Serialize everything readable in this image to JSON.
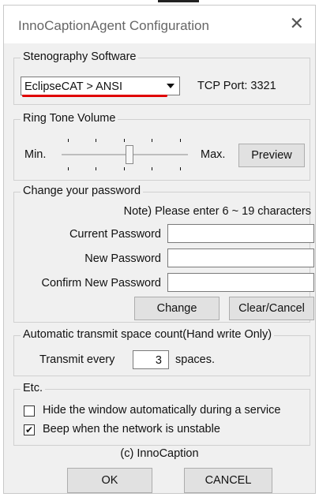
{
  "window": {
    "title": "InnoCaptionAgent Configuration",
    "close_glyph": "✕"
  },
  "steno": {
    "legend": "Stenography Software",
    "selected": "EclipseCAT > ANSI",
    "dropdown_glyph": "▼",
    "tcp_port": "TCP Port: 3321"
  },
  "ring": {
    "legend": "Ring Tone Volume",
    "min_label": "Min.",
    "max_label": "Max.",
    "volume_fraction": 0.55,
    "preview_label": "Preview"
  },
  "password": {
    "legend": "Change your password",
    "note": "Note) Please enter 6 ~ 19 characters",
    "current_label": "Current Password",
    "new_label": "New Password",
    "confirm_label": "Confirm New Password",
    "current_value": "",
    "new_value": "",
    "confirm_value": "",
    "change_label": "Change",
    "clear_label": "Clear/Cancel"
  },
  "transmit": {
    "legend": "Automatic transmit space count(Hand write Only)",
    "prefix": "Transmit every",
    "value": "3",
    "suffix": "spaces."
  },
  "etc": {
    "legend": "Etc.",
    "hide_label": "Hide the window automatically during a service",
    "hide_checked": "",
    "beep_label": "Beep when the network is unstable",
    "beep_checked": "✔"
  },
  "footer": {
    "copyright": "(c) InnoCaption",
    "ok_label": "OK",
    "cancel_label": "CANCEL"
  },
  "colors": {
    "highlight": "#e00000",
    "dialog_bg": "#f0f0f0"
  }
}
